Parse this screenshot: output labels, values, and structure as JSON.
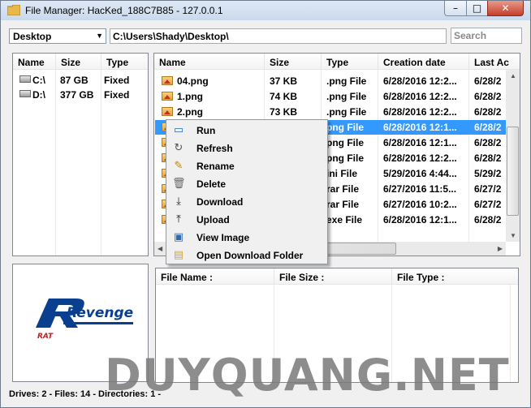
{
  "window": {
    "title": "File Manager: HacKed_188C7B85 - 127.0.0.1",
    "min_glyph": "–",
    "max_glyph": "□",
    "close_glyph": "✕"
  },
  "toolbar": {
    "location_value": "Desktop",
    "path_value": "C:\\Users\\Shady\\Desktop\\",
    "search_placeholder": "Search"
  },
  "drives_panel": {
    "columns": [
      "Name",
      "Size",
      "Type"
    ],
    "rows": [
      {
        "name": "C:\\",
        "size": "87 GB",
        "type": "Fixed"
      },
      {
        "name": "D:\\",
        "size": "377 GB",
        "type": "Fixed"
      }
    ]
  },
  "files_panel": {
    "columns": [
      "Name",
      "Size",
      "Type",
      "Creation date",
      "Last Ac"
    ],
    "rows": [
      {
        "name": "04.png",
        "size": "37 KB",
        "type": ".png File",
        "created": "6/28/2016 12:2...",
        "last": "6/28/2"
      },
      {
        "name": "1.png",
        "size": "74 KB",
        "type": ".png File",
        "created": "6/28/2016 12:2...",
        "last": "6/28/2"
      },
      {
        "name": "2.png",
        "size": "73 KB",
        "type": ".png File",
        "created": "6/28/2016 12:2...",
        "last": "6/28/2"
      },
      {
        "name": "",
        "size": "",
        "type": "png File",
        "created": "6/28/2016 12:1...",
        "last": "6/28/2",
        "selected": true
      },
      {
        "name": "",
        "size": "",
        "type": "png File",
        "created": "6/28/2016 12:1...",
        "last": "6/28/2"
      },
      {
        "name": "",
        "size": "",
        "type": "png File",
        "created": "6/28/2016 12:2...",
        "last": "6/28/2"
      },
      {
        "name": "",
        "size": "",
        "type": "ini File",
        "created": "5/29/2016 4:44...",
        "last": "5/29/2"
      },
      {
        "name": "",
        "size": "",
        "type": "rar File",
        "created": "6/27/2016 11:5...",
        "last": "6/27/2"
      },
      {
        "name": "",
        "size": "",
        "type": "rar File",
        "created": "6/27/2016 10:2...",
        "last": "6/27/2"
      },
      {
        "name": "",
        "size": "",
        "type": "exe File",
        "created": "6/28/2016 12:1...",
        "last": "6/28/2"
      }
    ]
  },
  "context_menu": {
    "items": [
      {
        "label": "Run",
        "icon": "window-icon"
      },
      {
        "label": "Refresh",
        "icon": "refresh-icon"
      },
      {
        "label": "Rename",
        "icon": "rename-icon"
      },
      {
        "label": "Delete",
        "icon": "trash-icon"
      },
      {
        "label": "Download",
        "icon": "download-icon"
      },
      {
        "label": "Upload",
        "icon": "upload-icon"
      },
      {
        "label": "View Image",
        "icon": "image-icon"
      },
      {
        "label": "Open Download Folder",
        "icon": "folder-icon"
      }
    ]
  },
  "transfer_panel": {
    "columns": [
      "File Name :",
      "File Size :",
      "File Type :"
    ]
  },
  "logo": {
    "brand": "Revenge",
    "sub": "RAT"
  },
  "status": {
    "text": "Drives: 2 -  Files: 14  -  Directories: 1  -"
  },
  "watermark": "DUYQUANG.NET",
  "colors": {
    "selection": "#3399ff",
    "logo_blue": "#0a3f8f",
    "logo_red": "#c41e1e"
  }
}
